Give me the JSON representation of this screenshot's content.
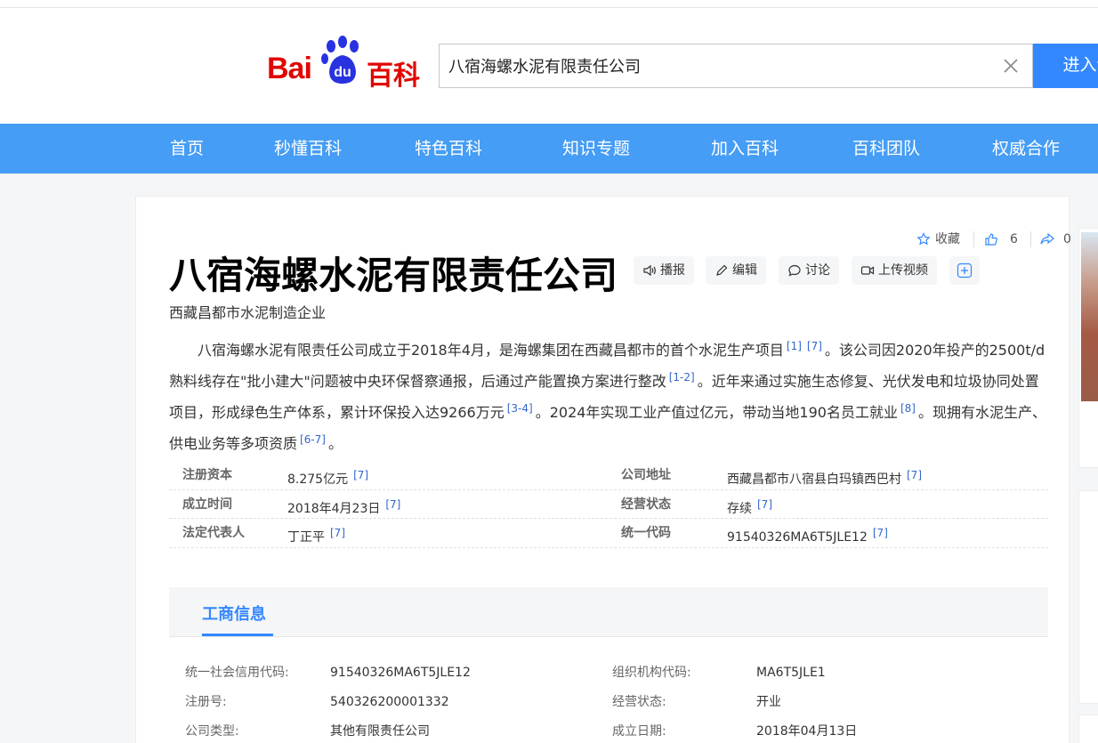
{
  "header": {
    "logo_text_bai": "Bai",
    "logo_text_du": "du",
    "logo_text_baike": "百科",
    "search_value": "八宿海螺水泥有限责任公司",
    "search_button": "进入词条"
  },
  "nav": {
    "items": [
      "首页",
      "秒懂百科",
      "特色百科",
      "知识专题",
      "加入百科",
      "百科团队",
      "权威合作"
    ]
  },
  "actions": {
    "collect": "收藏",
    "like_count": "6",
    "share_count": "0"
  },
  "entry": {
    "title": "八宿海螺水泥有限责任公司",
    "subtitle": "西藏昌都市水泥制造企业",
    "tools": [
      "播报",
      "编辑",
      "讨论",
      "上传视频"
    ]
  },
  "summary": {
    "s1": "八宿海螺水泥有限责任公司成立于2018年4月，是海螺集团在西藏昌都市的首个水泥生产项目",
    "r1": "[1]",
    "r2": "[7]",
    "s2": "。该公司因2020年投产的2500t/d熟料线存在\"批小建大\"问题被中央环保督察通报，后通过产能置换方案进行整改",
    "r3": "[1-2]",
    "s3": "。近年来通过实施生态修复、光伏发电和垃圾协同处置项目，形成绿色生产体系，累计环保投入达9266万元",
    "r4": "[3-4]",
    "s4": "。2024年实现工业产值过亿元，带动当地190名员工就业",
    "r5": "[8]",
    "s5": "。现拥有水泥生产、供电业务等多项资质",
    "r6": "[6-7]",
    "s6": "。"
  },
  "basic_info": {
    "rows": [
      {
        "l1": "注册资本",
        "v1": "8.275亿元",
        "r1": "[7]",
        "l2": "公司地址",
        "v2": "西藏昌都市八宿县白玛镇西巴村",
        "r2": "[7]"
      },
      {
        "l1": "成立时间",
        "v1": "2018年4月23日",
        "r1": "[7]",
        "l2": "经营状态",
        "v2": "存续",
        "r2": "[7]"
      },
      {
        "l1": "法定代表人",
        "v1": "丁正平",
        "r1": "[7]",
        "l2": "统一代码",
        "v2": "91540326MA6T5JLE12",
        "r2": "[7]"
      }
    ]
  },
  "business": {
    "tab": "工商信息",
    "rows": [
      {
        "l1": "统一社会信用代码:",
        "v1": "91540326MA6T5JLE12",
        "l2": "组织机构代码:",
        "v2": "MA6T5JLE1"
      },
      {
        "l1": "注册号:",
        "v1": "540326200001332",
        "l2": "经营状态:",
        "v2": "开业"
      },
      {
        "l1": "公司类型:",
        "v1": "其他有限责任公司",
        "l2": "成立日期:",
        "v2": "2018年04月13日"
      }
    ]
  },
  "colors": {
    "brand_red": "#e10601",
    "brand_blue": "#3388ff",
    "nav_blue": "#459df5",
    "link_blue": "#3366cc"
  }
}
